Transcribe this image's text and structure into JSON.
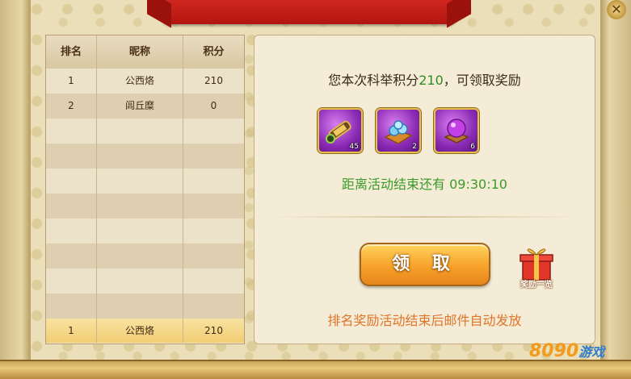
{
  "rank_table": {
    "headers": [
      "排名",
      "昵称",
      "积分"
    ],
    "rows": [
      {
        "rank": "1",
        "name": "公西烙",
        "score": "210"
      },
      {
        "rank": "2",
        "name": "闾丘糜",
        "score": "0"
      },
      {
        "rank": "",
        "name": "",
        "score": ""
      },
      {
        "rank": "",
        "name": "",
        "score": ""
      },
      {
        "rank": "",
        "name": "",
        "score": ""
      },
      {
        "rank": "",
        "name": "",
        "score": ""
      },
      {
        "rank": "",
        "name": "",
        "score": ""
      },
      {
        "rank": "",
        "name": "",
        "score": ""
      },
      {
        "rank": "",
        "name": "",
        "score": ""
      },
      {
        "rank": "",
        "name": "",
        "score": ""
      }
    ],
    "my_row": {
      "rank": "1",
      "name": "公西烙",
      "score": "210"
    }
  },
  "reward_panel": {
    "score_prefix": "您本次科举积分",
    "score_value": "210",
    "score_suffix": "，可领取奖励",
    "items": [
      {
        "icon": "scroll-icon",
        "count": "45"
      },
      {
        "icon": "gem-tray-icon",
        "count": "2"
      },
      {
        "icon": "purple-orb-icon",
        "count": "6"
      }
    ],
    "countdown_label": "距离活动结束还有",
    "countdown_time": "09:30:10",
    "claim_label": "领 取",
    "gift_label": "奖励一览",
    "notice": "排名奖励活动结束后邮件自动发放"
  },
  "watermark": {
    "brand": "8090",
    "suffix": "游戏"
  },
  "colors": {
    "highlight_green": "#2b8d24",
    "notice_orange": "#e0752a",
    "button_orange": "#f7a22a",
    "banner_red": "#c71f18"
  }
}
